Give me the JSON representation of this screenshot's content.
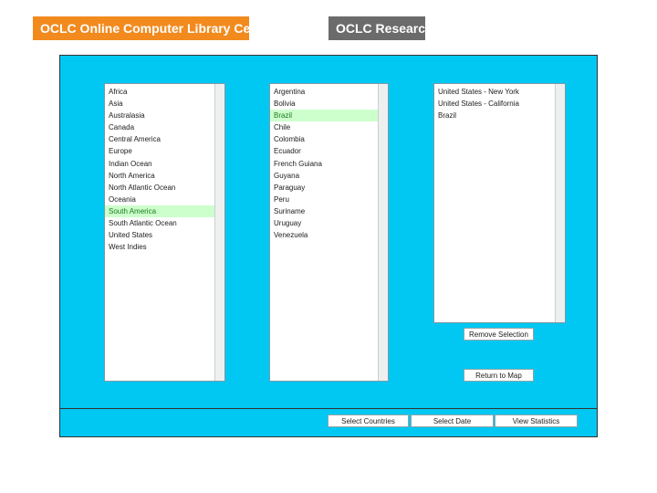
{
  "header": {
    "oclc_logo": "OCLC Online Computer Library Center",
    "research_logo": "OCLC Research"
  },
  "regions": {
    "items": [
      "Africa",
      "Asia",
      "Australasia",
      "Canada",
      "Central America",
      "Europe",
      "Indian Ocean",
      "North America",
      "North Atlantic Ocean",
      "Oceania",
      "South America",
      "South Atlantic Ocean",
      "United States",
      "West Indies"
    ],
    "selected": "South America"
  },
  "countries": {
    "items": [
      "Argentina",
      "Bolivia",
      "Brazil",
      "Chile",
      "Colombia",
      "Ecuador",
      "French Guiana",
      "Guyana",
      "Paraguay",
      "Peru",
      "Suriname",
      "Uruguay",
      "Venezuela"
    ],
    "selected": "Brazil"
  },
  "selection": {
    "items": [
      "United States - New York",
      "United States - California",
      "Brazil"
    ]
  },
  "buttons": {
    "remove_selection": "Remove Selection",
    "return_to_map": "Return to Map",
    "select_countries": "Select Countries",
    "select_date": "Select Date",
    "view_statistics": "View Statistics"
  },
  "colors": {
    "panel": "#00c8f2",
    "oclc_logo": "#f28a1e",
    "research_logo": "#6b6b6b",
    "selected_row": "#ccffcc"
  }
}
